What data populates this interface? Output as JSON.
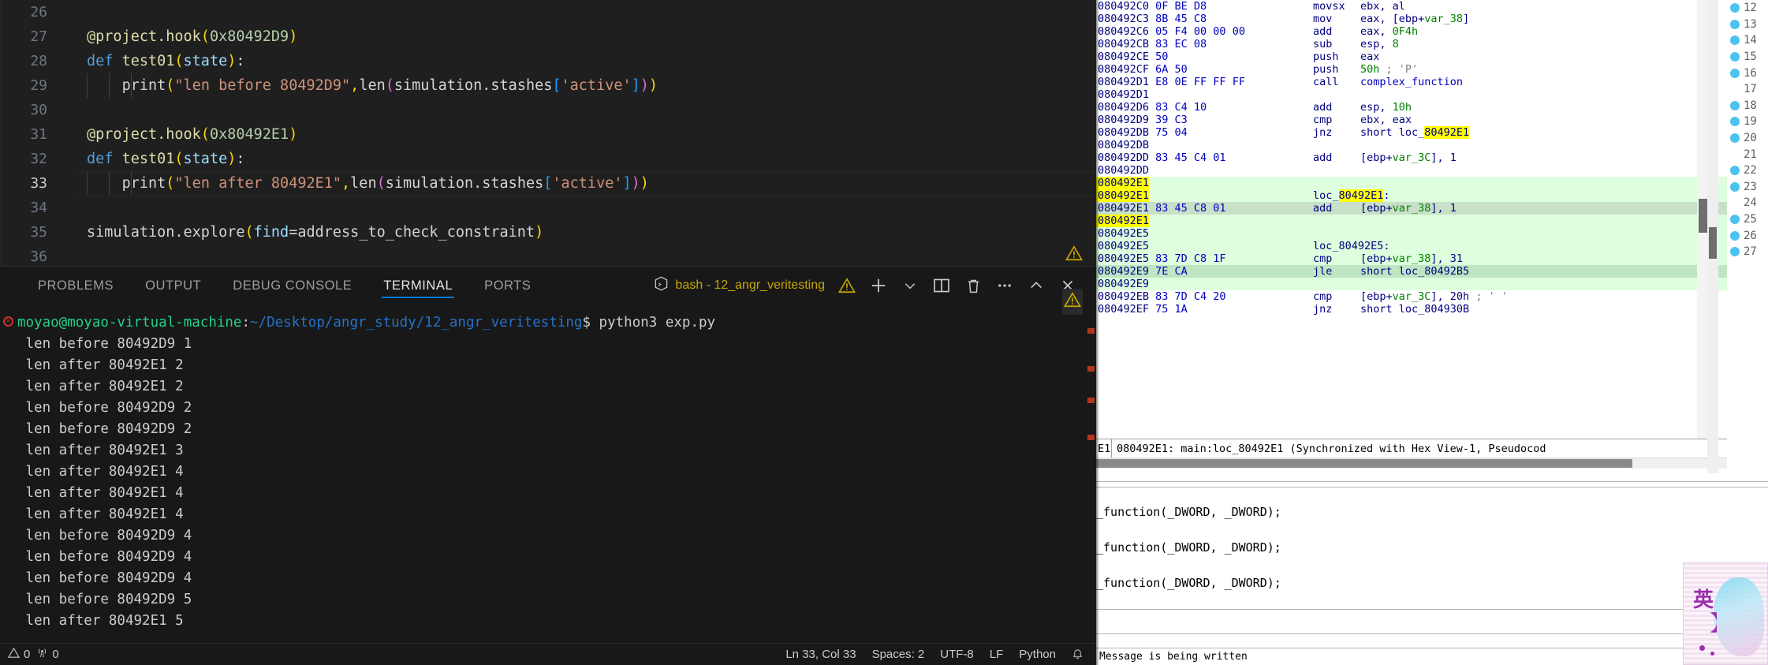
{
  "editor": {
    "language": "Python",
    "lines": [
      {
        "number": "26",
        "active": false,
        "tokens": []
      },
      {
        "number": "27",
        "active": false,
        "tokens": [
          {
            "t": "@project.hook",
            "c": "t-dec"
          },
          {
            "t": "(",
            "c": "t-punc"
          },
          {
            "t": "0x80492D9",
            "c": "t-num"
          },
          {
            "t": ")",
            "c": "t-punc"
          }
        ]
      },
      {
        "number": "28",
        "active": false,
        "tokens": [
          {
            "t": "def",
            "c": "t-kw"
          },
          {
            "t": " ",
            "c": "t-plain"
          },
          {
            "t": "test01",
            "c": "t-fn"
          },
          {
            "t": "(",
            "c": "t-punc"
          },
          {
            "t": "state",
            "c": "t-param"
          },
          {
            "t": ")",
            "c": "t-punc"
          },
          {
            "t": ":",
            "c": "t-plain"
          }
        ]
      },
      {
        "number": "29",
        "active": false,
        "tokens": [
          {
            "t": "    ",
            "c": "t-plain"
          },
          {
            "t": "print",
            "c": "t-plain"
          },
          {
            "t": "(",
            "c": "t-punc"
          },
          {
            "t": "\"len before 80492D9\"",
            "c": "t-str"
          },
          {
            "t": ",",
            "c": "t-punc"
          },
          {
            "t": "len",
            "c": "t-plain"
          },
          {
            "t": "(",
            "c": "t-punc2"
          },
          {
            "t": "simulation",
            "c": "t-plain"
          },
          {
            "t": ".",
            "c": "t-plain"
          },
          {
            "t": "stashes",
            "c": "t-plain"
          },
          {
            "t": "[",
            "c": "t-punc3"
          },
          {
            "t": "'active'",
            "c": "t-str"
          },
          {
            "t": "]",
            "c": "t-punc3"
          },
          {
            "t": ")",
            "c": "t-punc2"
          },
          {
            "t": ")",
            "c": "t-punc"
          }
        ]
      },
      {
        "number": "30",
        "active": false,
        "tokens": []
      },
      {
        "number": "31",
        "active": false,
        "tokens": [
          {
            "t": "@project.hook",
            "c": "t-dec"
          },
          {
            "t": "(",
            "c": "t-punc"
          },
          {
            "t": "0x80492E1",
            "c": "t-num"
          },
          {
            "t": ")",
            "c": "t-punc"
          }
        ]
      },
      {
        "number": "32",
        "active": false,
        "tokens": [
          {
            "t": "def",
            "c": "t-kw"
          },
          {
            "t": " ",
            "c": "t-plain"
          },
          {
            "t": "test01",
            "c": "t-fn"
          },
          {
            "t": "(",
            "c": "t-punc"
          },
          {
            "t": "state",
            "c": "t-param"
          },
          {
            "t": ")",
            "c": "t-punc"
          },
          {
            "t": ":",
            "c": "t-plain"
          }
        ]
      },
      {
        "number": "33",
        "active": true,
        "tokens": [
          {
            "t": "    ",
            "c": "t-plain"
          },
          {
            "t": "print",
            "c": "t-plain"
          },
          {
            "t": "(",
            "c": "t-punc"
          },
          {
            "t": "\"len after 80492E1\"",
            "c": "t-str"
          },
          {
            "t": ",",
            "c": "t-punc"
          },
          {
            "t": "len",
            "c": "t-plain"
          },
          {
            "t": "(",
            "c": "t-punc2"
          },
          {
            "t": "simulation",
            "c": "t-plain"
          },
          {
            "t": ".",
            "c": "t-plain"
          },
          {
            "t": "stashes",
            "c": "t-plain"
          },
          {
            "t": "[",
            "c": "t-punc3"
          },
          {
            "t": "'active'",
            "c": "t-str"
          },
          {
            "t": "]",
            "c": "t-punc3"
          },
          {
            "t": ")",
            "c": "t-punc2"
          },
          {
            "t": ")",
            "c": "t-punc"
          }
        ]
      },
      {
        "number": "34",
        "active": false,
        "tokens": []
      },
      {
        "number": "35",
        "active": false,
        "tokens": [
          {
            "t": "simulation",
            "c": "t-plain"
          },
          {
            "t": ".",
            "c": "t-plain"
          },
          {
            "t": "explore",
            "c": "t-plain"
          },
          {
            "t": "(",
            "c": "t-punc"
          },
          {
            "t": "find",
            "c": "t-param"
          },
          {
            "t": "=",
            "c": "t-plain"
          },
          {
            "t": "address_to_check_constraint",
            "c": "t-plain"
          },
          {
            "t": ")",
            "c": "t-punc"
          }
        ]
      },
      {
        "number": "36",
        "active": false,
        "tokens": []
      }
    ]
  },
  "panel": {
    "tabs": [
      {
        "label": "PROBLEMS",
        "active": false
      },
      {
        "label": "OUTPUT",
        "active": false
      },
      {
        "label": "DEBUG CONSOLE",
        "active": false
      },
      {
        "label": "TERMINAL",
        "active": true
      },
      {
        "label": "PORTS",
        "active": false
      }
    ],
    "terminal_name": "bash - 12_angr_veritesting",
    "actions": [
      {
        "name": "warning-icon",
        "glyph": "warn"
      },
      {
        "name": "new-terminal-button",
        "glyph": "plus"
      },
      {
        "name": "terminal-dropdown-button",
        "glyph": "chevron-down"
      },
      {
        "name": "split-terminal-button",
        "glyph": "split"
      },
      {
        "name": "kill-terminal-button",
        "glyph": "trash"
      },
      {
        "name": "more-actions-button",
        "glyph": "ellipsis"
      },
      {
        "name": "maximize-panel-button",
        "glyph": "chevron-up"
      },
      {
        "name": "close-panel-button",
        "glyph": "close"
      }
    ]
  },
  "terminal": {
    "prompt": {
      "user_host": "moyao@moyao-virtual-machine",
      "separator": ":",
      "path": "~/Desktop/angr_study/12_angr_veritesting",
      "dollar": "$",
      "command": "python3 exp.py"
    },
    "output": [
      "len before 80492D9 1",
      "len after 80492E1 2",
      "len after 80492E1 2",
      "len before 80492D9 2",
      "len before 80492D9 2",
      "len after 80492E1 3",
      "len after 80492E1 4",
      "len after 80492E1 4",
      "len after 80492E1 4",
      "len before 80492D9 4",
      "len before 80492D9 4",
      "len before 80492D9 4",
      "len before 80492D9 5",
      "len after 80492E1 5"
    ]
  },
  "statusbar": {
    "errors": "0",
    "warnings": "0",
    "cursor": "Ln 33, Col 33",
    "indent": "Spaces: 2",
    "encoding": "UTF-8",
    "eol": "LF",
    "language": "Python"
  },
  "ida": {
    "disasm": [
      {
        "addr": "080492C0",
        "bytes": "0F BE D8",
        "mnem": "movsx",
        "ops": [
          {
            "t": "ebx, ",
            "c": "op-reg"
          },
          {
            "t": "al",
            "c": "op-reg"
          }
        ],
        "bg": ""
      },
      {
        "addr": "080492C3",
        "bytes": "8B 45 C8",
        "mnem": "mov",
        "ops": [
          {
            "t": "eax, [ebp+",
            "c": "op-reg"
          },
          {
            "t": "var_38",
            "c": "op-var"
          },
          {
            "t": "]",
            "c": "op-reg"
          }
        ],
        "bg": ""
      },
      {
        "addr": "080492C6",
        "bytes": "05 F4 00 00 00",
        "mnem": "add",
        "ops": [
          {
            "t": "eax, ",
            "c": "op-reg"
          },
          {
            "t": "0F4h",
            "c": "op-num"
          }
        ],
        "bg": ""
      },
      {
        "addr": "080492CB",
        "bytes": "83 EC 08",
        "mnem": "sub",
        "ops": [
          {
            "t": "esp, ",
            "c": "op-reg"
          },
          {
            "t": "8",
            "c": "op-num"
          }
        ],
        "bg": ""
      },
      {
        "addr": "080492CE",
        "bytes": "50",
        "mnem": "push",
        "ops": [
          {
            "t": "eax",
            "c": "op-reg"
          }
        ],
        "bg": ""
      },
      {
        "addr": "080492CF",
        "bytes": "6A 50",
        "mnem": "push",
        "ops": [
          {
            "t": "50h",
            "c": "op-num"
          },
          {
            "t": " ; 'P'",
            "c": "op-cmt"
          }
        ],
        "bg": ""
      },
      {
        "addr": "080492D1",
        "bytes": "E8 0E FF FF FF",
        "mnem": "call",
        "ops": [
          {
            "t": "complex_function",
            "c": "op-name"
          }
        ],
        "bg": ""
      },
      {
        "addr": "080492D1",
        "bytes": "",
        "mnem": "",
        "ops": [],
        "bg": ""
      },
      {
        "addr": "080492D6",
        "bytes": "83 C4 10",
        "mnem": "add",
        "ops": [
          {
            "t": "esp, ",
            "c": "op-reg"
          },
          {
            "t": "10h",
            "c": "op-num"
          }
        ],
        "bg": ""
      },
      {
        "addr": "080492D9",
        "bytes": "39 C3",
        "mnem": "cmp",
        "ops": [
          {
            "t": "ebx, eax",
            "c": "op-reg"
          }
        ],
        "bg": ""
      },
      {
        "addr": "080492DB",
        "bytes": "75 04",
        "mnem": "jnz",
        "ops": [
          {
            "t": "short loc_",
            "c": "op-reg"
          },
          {
            "t": "80492E1",
            "c": "op-reg hl-yellow"
          }
        ],
        "bg": ""
      },
      {
        "addr": "080492DB",
        "bytes": "",
        "mnem": "",
        "ops": [],
        "bg": ""
      },
      {
        "addr": "080492DD",
        "bytes": "83 45 C4 01",
        "mnem": "add",
        "ops": [
          {
            "t": "[ebp+",
            "c": "op-reg"
          },
          {
            "t": "var_3C",
            "c": "op-var"
          },
          {
            "t": "], 1",
            "c": "op-reg"
          }
        ],
        "bg": ""
      },
      {
        "addr": "080492DD",
        "bytes": "",
        "mnem": "",
        "ops": [],
        "bg": ""
      },
      {
        "addr": "080492E1",
        "bytes": "",
        "mnem": "",
        "ops": [],
        "bg": "row-green",
        "addr_hl": true
      },
      {
        "addr": "080492E1",
        "bytes": "",
        "mnem": "",
        "ops": [
          {
            "t": "loc_",
            "c": "op-reg"
          },
          {
            "t": "80492E1",
            "c": "op-reg hl-yellow"
          },
          {
            "t": ":",
            "c": "op-reg"
          }
        ],
        "bg": "row-green",
        "addr_hl": true,
        "label": true
      },
      {
        "addr": "080492E1",
        "bytes": "83 45 C8 01",
        "mnem": "add",
        "ops": [
          {
            "t": "[ebp+",
            "c": "op-reg"
          },
          {
            "t": "var_38",
            "c": "op-var"
          },
          {
            "t": "], 1",
            "c": "op-reg"
          }
        ],
        "bg": "row-sel"
      },
      {
        "addr": "080492E1",
        "bytes": "",
        "mnem": "",
        "ops": [],
        "bg": "row-green",
        "addr_hl": true
      },
      {
        "addr": "080492E5",
        "bytes": "",
        "mnem": "",
        "ops": [],
        "bg": "row-green"
      },
      {
        "addr": "080492E5",
        "bytes": "",
        "mnem": "",
        "ops": [
          {
            "t": "loc_80492E5:",
            "c": "op-reg"
          }
        ],
        "bg": "row-green",
        "label": true
      },
      {
        "addr": "080492E5",
        "bytes": "83 7D C8 1F",
        "mnem": "cmp",
        "ops": [
          {
            "t": "[ebp+",
            "c": "op-reg"
          },
          {
            "t": "var_38",
            "c": "op-var"
          },
          {
            "t": "], 31",
            "c": "op-reg"
          }
        ],
        "bg": "row-green"
      },
      {
        "addr": "080492E9",
        "bytes": "7E CA",
        "mnem": "jle",
        "ops": [
          {
            "t": "short loc_80492B5",
            "c": "op-reg"
          }
        ],
        "bg": "row-green2"
      },
      {
        "addr": "080492E9",
        "bytes": "",
        "mnem": "",
        "ops": [],
        "bg": "row-green"
      },
      {
        "addr": "080492EB",
        "bytes": "83 7D C4 20",
        "mnem": "cmp",
        "ops": [
          {
            "t": "[ebp+",
            "c": "op-reg"
          },
          {
            "t": "var_3C",
            "c": "op-var"
          },
          {
            "t": "], 20h",
            "c": "op-reg"
          },
          {
            "t": " ; ' '",
            "c": "op-cmt"
          }
        ],
        "bg": ""
      },
      {
        "addr": "080492EF",
        "bytes": "75 1A",
        "mnem": "jnz",
        "ops": [
          {
            "t": "short loc_804930B",
            "c": "op-reg"
          }
        ],
        "bg": ""
      }
    ],
    "status_prefix": "E1",
    "status_text": "080492E1: main:loc_80492E1 (Synchronized with Hex View-1, Pseudocod",
    "pseudocode": [
      "_function(_DWORD, _DWORD);",
      "_function(_DWORD, _DWORD);",
      "_function(_DWORD, _DWORD);"
    ],
    "pseudocode_status": "Message is being written",
    "side_numbers": [
      {
        "n": "12",
        "dot": true
      },
      {
        "n": "13",
        "dot": true
      },
      {
        "n": "14",
        "dot": true
      },
      {
        "n": "15",
        "dot": true
      },
      {
        "n": "16",
        "dot": true
      },
      {
        "n": "17",
        "dot": false
      },
      {
        "n": "18",
        "dot": true
      },
      {
        "n": "19",
        "dot": true
      },
      {
        "n": "20",
        "dot": true
      },
      {
        "n": "21",
        "dot": false
      },
      {
        "n": "22",
        "dot": true
      },
      {
        "n": "23",
        "dot": true
      },
      {
        "n": "24",
        "dot": false
      },
      {
        "n": "25",
        "dot": true
      },
      {
        "n": "26",
        "dot": true
      },
      {
        "n": "27",
        "dot": true
      }
    ],
    "sticker_char": "英"
  }
}
